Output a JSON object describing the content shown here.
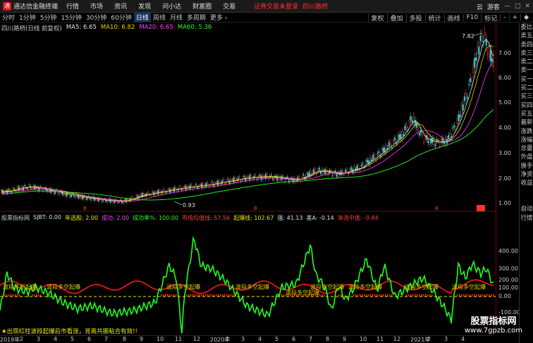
{
  "app": {
    "title": "通达信金融终端",
    "logo": "通"
  },
  "menu": [
    "行情",
    "市场",
    "资讯",
    "发现",
    "问小达",
    "财富圈",
    "交易"
  ],
  "alert": "证券交易未登录",
  "current_stock": "四川路桥",
  "top_right": [
    "云",
    "游客"
  ],
  "window_controls": [
    "—",
    "□",
    "✕"
  ],
  "periods": [
    "分时",
    "1分钟",
    "5分钟",
    "15分钟",
    "30分钟",
    "60分钟",
    "日线",
    "周线",
    "月线",
    "多周期",
    "更多 ›"
  ],
  "active_period": "日线",
  "tools": [
    "复权",
    "叠加",
    "多股",
    "统计",
    "画线",
    "F10",
    "标记",
    "-",
    "+",
    "◆"
  ],
  "main_legend": {
    "stock": "四川路桥(日线 前复权)",
    "ma5": "MA5: 6.65",
    "ma10": "MA10: 6.82",
    "ma20": "MA20: 6.65",
    "ma60": "MA60: 5.36"
  },
  "price_axis": [
    "7.00",
    "6.00",
    "5.00",
    "4.00",
    "3.00",
    "2.00",
    "1.00"
  ],
  "price_annotations": {
    "high": "7.82",
    "low": "0.93"
  },
  "indicator_legend": [
    {
      "text": "股票指标网",
      "color": "#c8c8c8"
    },
    {
      "text": "SJBT: 0.00",
      "color": "#e0e0e0"
    },
    {
      "text": "年选股: 2.00",
      "color": "#e8e800"
    },
    {
      "text": "成功: 2.00",
      "color": "#ff40ff"
    },
    {
      "text": "成功率%: 100.00",
      "color": "#20ff20"
    },
    {
      "text": "市场均值线: 57.56",
      "color": "#ff4040"
    },
    {
      "text": "起爆线: 102.67",
      "color": "#e8e800"
    },
    {
      "text": "强: 41.13",
      "color": "#e0e0e0"
    },
    {
      "text": "差A: -0.14",
      "color": "#e0e0e0"
    },
    {
      "text": "净流中值: -0.84",
      "color": "#ff4040"
    }
  ],
  "indicator_axis": [
    "400.00",
    "300.00",
    "200.00",
    "100.00",
    "0.00",
    "-100.00"
  ],
  "signal_label": "波段多空起爆",
  "right_column": [
    "委比",
    "卖五",
    "卖四",
    "卖三",
    "卖二",
    "卖一",
    "买一",
    "买二",
    "买三",
    "买四",
    "买五",
    "最新",
    "涨跌",
    "涨幅",
    "总量",
    "外盘",
    "换手",
    "净资",
    "收益",
    "",
    "",
    "自动",
    "行情"
  ],
  "note": "★出现红柱波段起爆后市看涨，背离共振粘合有效!!",
  "watermark": {
    "line1": "股票指标网",
    "line2": "www.7gpzb.com"
  },
  "date_axis": [
    "2019年",
    "2",
    "3",
    "4",
    "5",
    "6",
    "7",
    "8",
    "9",
    "10",
    "11",
    "12",
    "2020年",
    "2",
    "3",
    "4",
    "5",
    "6",
    "7",
    "8",
    "9",
    "10",
    "11",
    "12",
    "2021年",
    "2",
    "3",
    "4"
  ],
  "colors": {
    "up": "#ff3030",
    "down": "#20d0d0",
    "ma5": "#e0e0e0",
    "ma10": "#e8d000",
    "ma20": "#ff40ff",
    "ma60": "#20ff20",
    "grid": "#7a0000"
  }
}
